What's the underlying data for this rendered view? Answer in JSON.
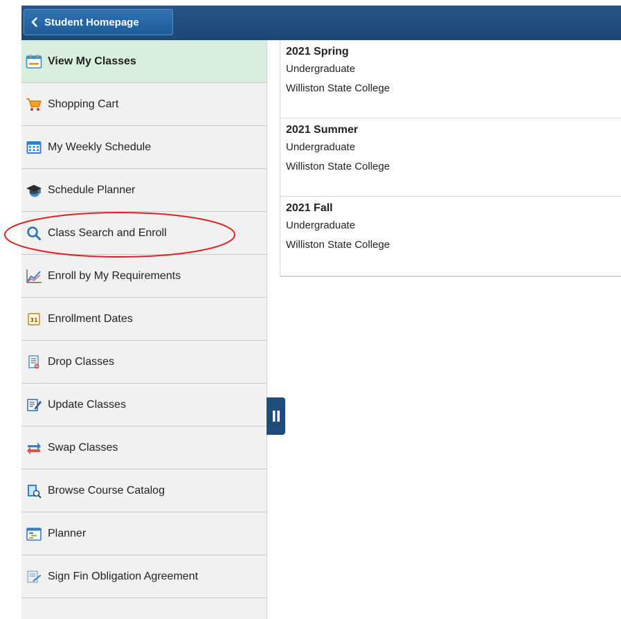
{
  "header": {
    "back_label": "Student Homepage"
  },
  "sidebar": {
    "items": [
      {
        "label": "View My Classes",
        "icon": "calendar-icon",
        "active": true
      },
      {
        "label": "Shopping Cart",
        "icon": "shopping-cart-icon"
      },
      {
        "label": "My Weekly Schedule",
        "icon": "weekly-calendar-icon"
      },
      {
        "label": "Schedule Planner",
        "icon": "graduation-cap-icon"
      },
      {
        "label": "Class Search and Enroll",
        "icon": "search-icon"
      },
      {
        "label": "Enroll by My Requirements",
        "icon": "line-chart-icon"
      },
      {
        "label": "Enrollment Dates",
        "icon": "date-31-icon"
      },
      {
        "label": "Drop Classes",
        "icon": "drop-document-icon"
      },
      {
        "label": "Update Classes",
        "icon": "edit-document-icon"
      },
      {
        "label": "Swap Classes",
        "icon": "swap-arrows-icon"
      },
      {
        "label": "Browse Course Catalog",
        "icon": "catalog-search-icon"
      },
      {
        "label": "Planner",
        "icon": "planner-icon"
      },
      {
        "label": "Sign Fin Obligation Agreement",
        "icon": "sign-document-icon"
      }
    ]
  },
  "terms": [
    {
      "title": "2021 Spring",
      "career": "Undergraduate",
      "institution": "Williston State College"
    },
    {
      "title": "2021 Summer",
      "career": "Undergraduate",
      "institution": "Williston State College"
    },
    {
      "title": "2021 Fall",
      "career": "Undergraduate",
      "institution": "Williston State College"
    }
  ],
  "colors": {
    "header": "#1c4676",
    "active_item": "#d9efdd",
    "highlight_oval": "#e02020"
  }
}
